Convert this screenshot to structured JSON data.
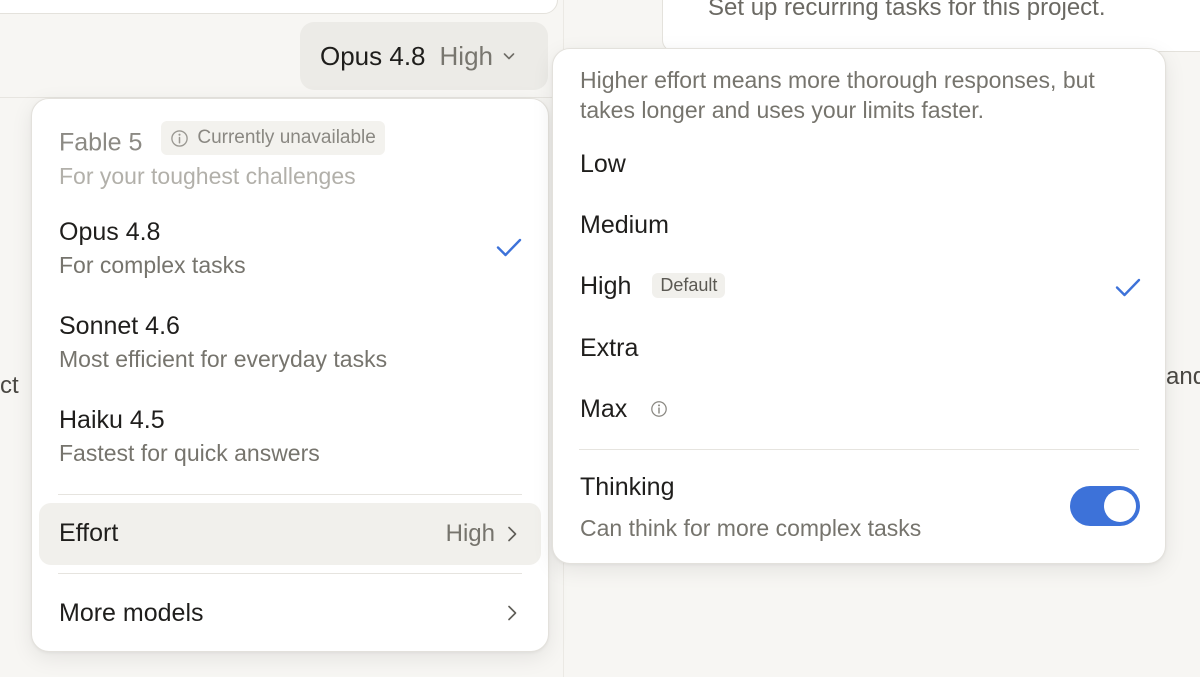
{
  "background": {
    "recurring_text": "Set up recurring tasks for this project.",
    "left_fragment": "ct",
    "right_fragment": "and"
  },
  "trigger": {
    "model": "Opus 4.8",
    "effort": "High"
  },
  "model_menu": {
    "items": [
      {
        "name": "Fable 5",
        "badge": "Currently unavailable",
        "description": "For your toughest challenges",
        "disabled": true,
        "selected": false
      },
      {
        "name": "Opus 4.8",
        "description": "For complex tasks",
        "disabled": false,
        "selected": true
      },
      {
        "name": "Sonnet 4.6",
        "description": "Most efficient for everyday tasks",
        "disabled": false,
        "selected": false
      },
      {
        "name": "Haiku 4.5",
        "description": "Fastest for quick answers",
        "disabled": false,
        "selected": false
      }
    ],
    "effort_label": "Effort",
    "effort_value": "High",
    "more_models_label": "More models"
  },
  "effort_menu": {
    "hint": "Higher effort means more thorough responses, but takes longer and uses your limits faster.",
    "options": [
      {
        "label": "Low"
      },
      {
        "label": "Medium"
      },
      {
        "label": "High",
        "badge": "Default",
        "selected": true
      },
      {
        "label": "Extra"
      },
      {
        "label": "Max",
        "info": true
      }
    ],
    "thinking": {
      "title": "Thinking",
      "description": "Can think for more complex tasks",
      "enabled": true
    }
  },
  "colors": {
    "accent": "#3d72d9",
    "toggle_on": "#3d72d9"
  }
}
